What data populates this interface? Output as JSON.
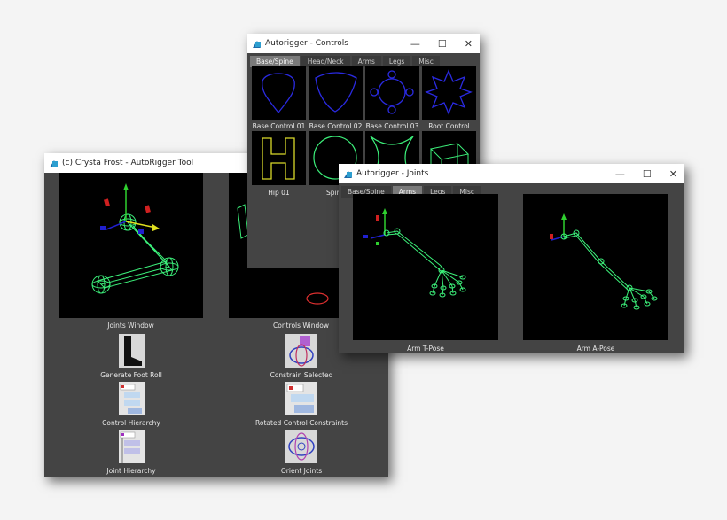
{
  "tool_window": {
    "title": "(c) Crysta Frost - AutoRigger Tool",
    "joints_label": "Joints Window",
    "controls_label": "Controls Window",
    "buttons": [
      {
        "label": "Generate Foot Roll",
        "icon": "foot-icon"
      },
      {
        "label": "Constrain Selected",
        "icon": "constrain-icon"
      },
      {
        "label": "Control Hierarchy",
        "icon": "hierarchy-icon"
      },
      {
        "label": "Rotated Control Constraints",
        "icon": "rotated-constraints-icon"
      },
      {
        "label": "Joint Hierarchy",
        "icon": "joint-hierarchy-icon"
      },
      {
        "label": "Orient Joints",
        "icon": "orient-icon"
      }
    ]
  },
  "controls_window": {
    "title": "Autorigger - Controls",
    "tabs": [
      "Base/Spine",
      "Head/Neck",
      "Arms",
      "Legs",
      "Misc"
    ],
    "active_tab": "Base/Spine",
    "items": [
      "Base Control 01",
      "Base Control 02",
      "Base Control 03",
      "Root Control",
      "Hip 01",
      "Spine"
    ]
  },
  "joints_window": {
    "title": "Autorigger - Joints",
    "tabs": [
      "Base/Spine",
      "Arms",
      "Legs",
      "Misc"
    ],
    "active_tab": "Arms",
    "items": [
      "Arm T-Pose",
      "Arm A-Pose"
    ]
  },
  "window_buttons": {
    "minimize": "—",
    "maximize": "☐",
    "close": "✕"
  },
  "colors": {
    "wire_green": "#3cf07a",
    "control_blue": "#2a2ae0",
    "control_yellow": "#d9d92a",
    "panel": "#444444"
  }
}
